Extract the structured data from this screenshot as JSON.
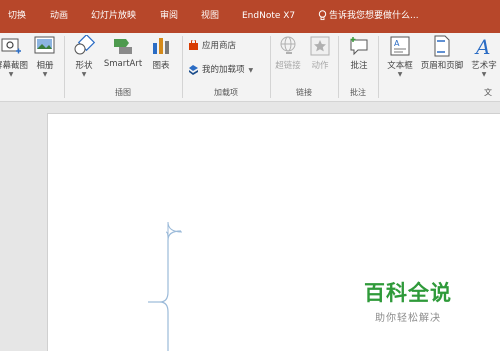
{
  "tabs": [
    {
      "label": "切换"
    },
    {
      "label": "动画"
    },
    {
      "label": "幻灯片放映"
    },
    {
      "label": "审阅"
    },
    {
      "label": "视图"
    },
    {
      "label": "EndNote X7"
    }
  ],
  "tell_me": {
    "placeholder": "告诉我您想要做什么..."
  },
  "ribbon": {
    "images_group": {
      "screenshot_label": "屏幕截图",
      "album_label": "相册",
      "group_label": ""
    },
    "illustrations_group": {
      "shapes_label": "形状",
      "smartart_label": "SmartArt",
      "chart_label": "图表",
      "group_label": "插图"
    },
    "addins_group": {
      "store_label": "应用商店",
      "my_addins_label": "我的加载项",
      "group_label": "加载项"
    },
    "links_group": {
      "hyperlink_label": "超链接",
      "action_label": "动作",
      "group_label": "链接"
    },
    "comments_group": {
      "comment_label": "批注",
      "group_label": "批注"
    },
    "text_group": {
      "textbox_label": "文本框",
      "header_footer_label": "页眉和页脚",
      "wordart_label": "艺术字",
      "group_label": "文"
    }
  },
  "watermark": {
    "title": "百科全说",
    "subtitle": "助你轻松解决"
  },
  "colors": {
    "tabbar": "#b7472a",
    "ribbon": "#f3f3f3",
    "workspace": "#e6e6e6",
    "watermark_green": "#2f9a3a"
  }
}
